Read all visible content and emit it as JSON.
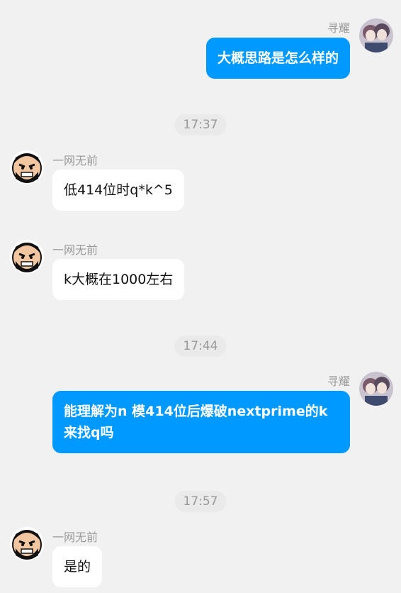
{
  "messages": [
    {
      "sender": "寻耀",
      "text": "大概思路是怎么样的"
    },
    {
      "time": "17:37"
    },
    {
      "sender": "一网无前",
      "text": "低414位时q*k^5"
    },
    {
      "sender": "一网无前",
      "text": "k大概在1000左右"
    },
    {
      "time": "17:44"
    },
    {
      "sender": "寻耀",
      "text": "能理解为n 模414位后爆破nextprime的k来找q吗"
    },
    {
      "time": "17:57"
    },
    {
      "sender": "一网无前",
      "text": "是的"
    }
  ],
  "colors": {
    "background": "#f1f1f1",
    "outgoing_bubble": "#0099ff",
    "incoming_bubble": "#ffffff"
  }
}
